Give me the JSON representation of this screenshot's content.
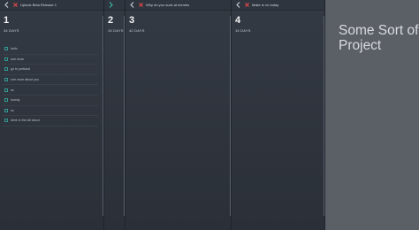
{
  "columns": [
    {
      "title": "Uplook Beta Release 1",
      "number": "1",
      "days": "34 DAYS",
      "items": [
        "hello",
        "one more",
        "go to portland",
        "one more about you",
        "ss",
        "howdy",
        "ss",
        "drink in the sill about"
      ]
    },
    {
      "title": "",
      "number": "2",
      "days": "15 DAYS",
      "items": []
    },
    {
      "title": "Why do you suck at memes",
      "number": "3",
      "days": "42 DAYS",
      "items": []
    },
    {
      "title": "Make is no today",
      "number": "4",
      "days": "15 DAYS",
      "items": []
    }
  ],
  "side_panel": {
    "title": "Some Sort of\nProject"
  },
  "colors": {
    "accent_red": "#e8474c",
    "accent_teal": "#36c2b4",
    "panel_bg": "#5b5f66"
  },
  "icons": {
    "back": "chevron-left-icon",
    "forward": "chevron-right-icon",
    "close": "close-x-icon",
    "task": "task-icon"
  }
}
